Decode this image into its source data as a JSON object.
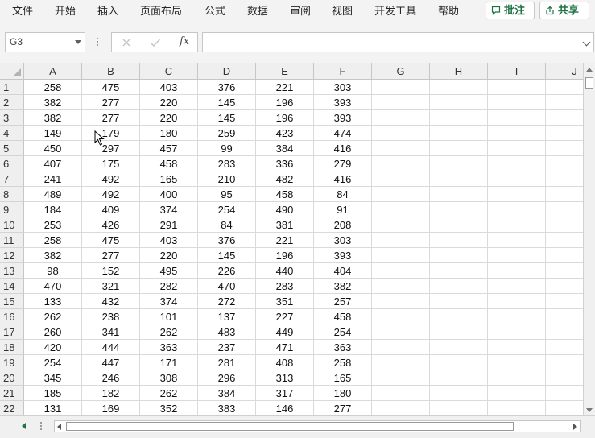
{
  "menu": {
    "items": [
      "文件",
      "开始",
      "插入",
      "页面布局",
      "公式",
      "数据",
      "审阅",
      "视图",
      "开发工具",
      "帮助"
    ],
    "comments_button": "批注",
    "share_button": "共享",
    "accent_color": "#217346"
  },
  "formula_bar": {
    "name_box": "G3",
    "fx_label": "fx",
    "formula_value": ""
  },
  "sheet": {
    "columns": [
      "A",
      "B",
      "C",
      "D",
      "E",
      "F",
      "G",
      "H",
      "I",
      "J"
    ],
    "rows": [
      {
        "n": "1",
        "cells": [
          "258",
          "475",
          "403",
          "376",
          "221",
          "303"
        ]
      },
      {
        "n": "2",
        "cells": [
          "382",
          "277",
          "220",
          "145",
          "196",
          "393"
        ]
      },
      {
        "n": "3",
        "cells": [
          "382",
          "277",
          "220",
          "145",
          "196",
          "393"
        ]
      },
      {
        "n": "4",
        "cells": [
          "149",
          "179",
          "180",
          "259",
          "423",
          "474"
        ]
      },
      {
        "n": "5",
        "cells": [
          "450",
          "297",
          "457",
          "99",
          "384",
          "416"
        ]
      },
      {
        "n": "6",
        "cells": [
          "407",
          "175",
          "458",
          "283",
          "336",
          "279"
        ]
      },
      {
        "n": "7",
        "cells": [
          "241",
          "492",
          "165",
          "210",
          "482",
          "416"
        ]
      },
      {
        "n": "8",
        "cells": [
          "489",
          "492",
          "400",
          "95",
          "458",
          "84"
        ]
      },
      {
        "n": "9",
        "cells": [
          "184",
          "409",
          "374",
          "254",
          "490",
          "91"
        ]
      },
      {
        "n": "10",
        "cells": [
          "253",
          "426",
          "291",
          "84",
          "381",
          "208"
        ]
      },
      {
        "n": "11",
        "cells": [
          "258",
          "475",
          "403",
          "376",
          "221",
          "303"
        ]
      },
      {
        "n": "12",
        "cells": [
          "382",
          "277",
          "220",
          "145",
          "196",
          "393"
        ]
      },
      {
        "n": "13",
        "cells": [
          "98",
          "152",
          "495",
          "226",
          "440",
          "404"
        ]
      },
      {
        "n": "14",
        "cells": [
          "470",
          "321",
          "282",
          "470",
          "283",
          "382"
        ]
      },
      {
        "n": "15",
        "cells": [
          "133",
          "432",
          "374",
          "272",
          "351",
          "257"
        ]
      },
      {
        "n": "16",
        "cells": [
          "262",
          "238",
          "101",
          "137",
          "227",
          "458"
        ]
      },
      {
        "n": "17",
        "cells": [
          "260",
          "341",
          "262",
          "483",
          "449",
          "254"
        ]
      },
      {
        "n": "18",
        "cells": [
          "420",
          "444",
          "363",
          "237",
          "471",
          "363"
        ]
      },
      {
        "n": "19",
        "cells": [
          "254",
          "447",
          "171",
          "281",
          "408",
          "258"
        ]
      },
      {
        "n": "20",
        "cells": [
          "345",
          "246",
          "308",
          "296",
          "313",
          "165"
        ]
      },
      {
        "n": "21",
        "cells": [
          "185",
          "182",
          "262",
          "384",
          "317",
          "180"
        ]
      },
      {
        "n": "22",
        "cells": [
          "131",
          "169",
          "352",
          "383",
          "146",
          "277"
        ]
      }
    ]
  }
}
